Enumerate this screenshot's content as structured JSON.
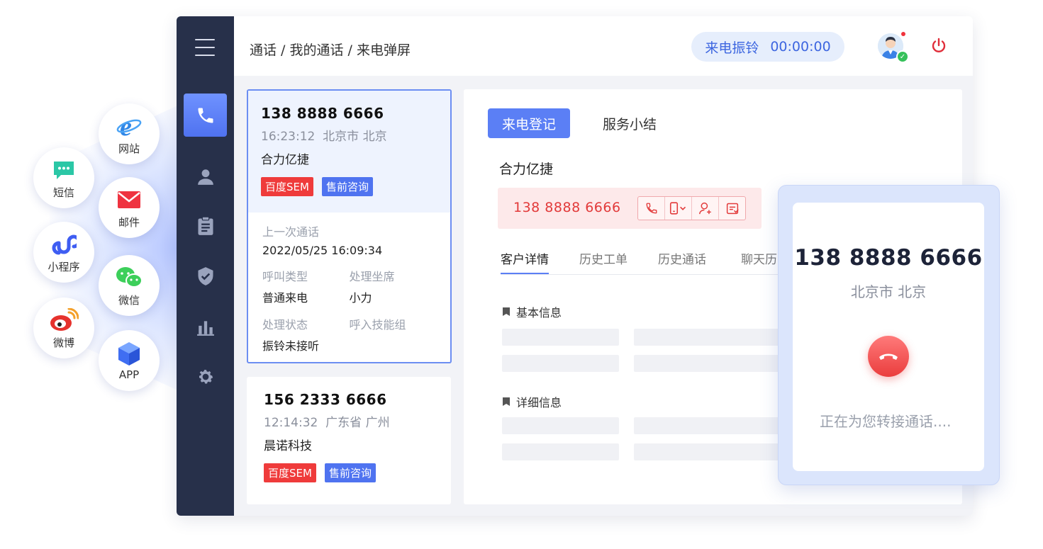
{
  "channels": {
    "website": "网站",
    "sms": "短信",
    "email": "邮件",
    "miniprogram": "小程序",
    "wechat": "微信",
    "weibo": "微博",
    "app": "APP"
  },
  "header": {
    "breadcrumb": "通话 / 我的通话 / 来电弹屏",
    "ring_status": "来电振铃",
    "timer": "00:00:00"
  },
  "calls": [
    {
      "number": "138 8888 6666",
      "time": "16:23:12",
      "location": "北京市 北京",
      "company": "合力亿捷",
      "tags": [
        "百度SEM",
        "售前咨询"
      ],
      "last_call_label": "上一次通话",
      "last_call_value": "2022/05/25  16:09:34",
      "call_type_label": "呼叫类型",
      "call_type_value": "普通来电",
      "agent_label": "处理坐席",
      "agent_value": "小力",
      "status_label": "处理状态",
      "status_value": "振铃未接听",
      "skill_label": "呼入技能组"
    },
    {
      "number": "156 2333 6666",
      "time": "12:14:32",
      "location": "广东省 广州",
      "company": "晨诺科技",
      "tags": [
        "百度SEM",
        "售前咨询"
      ]
    }
  ],
  "panel": {
    "tabs": [
      "来电登记",
      "服务小结"
    ],
    "customer_name": "合力亿捷",
    "phone": "138 8888 6666",
    "subtabs": [
      "客户详情",
      "历史工单",
      "历史通话",
      "聊天历"
    ],
    "section_basic": "基本信息",
    "section_detail": "详细信息"
  },
  "overlay": {
    "number": "138 8888 6666",
    "location": "北京市 北京",
    "status": "正在为您转接通话...."
  },
  "colors": {
    "sidebar": "#27304a",
    "accent": "#5b7ff5",
    "danger": "#ea3d3d"
  }
}
